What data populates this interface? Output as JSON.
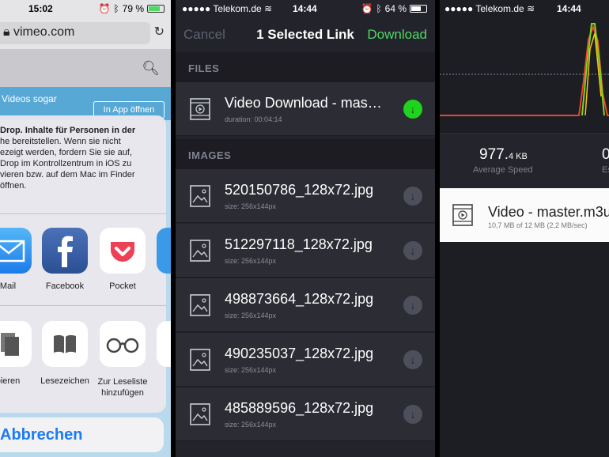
{
  "panel1": {
    "status": {
      "time": "15:02",
      "battery": "79 %",
      "battery_level": 0.79
    },
    "url": "vimeo.com",
    "web_text": "Videos sogar",
    "app_button": "In App öffnen",
    "airdrop_lines": [
      "Drop. Inhalte für Personen in der",
      "he bereitstellen. Wenn sie nicht",
      "ezeigt werden, fordern Sie sie auf,",
      "Drop im Kontrollzentrum in iOS zu",
      "vieren bzw. auf dem Mac im Finder",
      "öffnen."
    ],
    "apps": [
      {
        "label": "Mail"
      },
      {
        "label": "Facebook"
      },
      {
        "label": "Pocket"
      }
    ],
    "actions": [
      {
        "label": "pieren"
      },
      {
        "label": "Lesezeichen"
      },
      {
        "label": "Zur Leseliste"
      },
      {
        "label": "hinzufügen"
      }
    ],
    "cancel": "Abbrechen"
  },
  "panel2": {
    "status": {
      "carrier": "Telekom.de",
      "time": "14:44",
      "battery": "64 %",
      "battery_level": 0.64
    },
    "nav": {
      "cancel": "Cancel",
      "title": "1 Selected Link",
      "download": "Download"
    },
    "files_header": "FILES",
    "files": [
      {
        "title": "Video Download - mas…",
        "sub": "duration: 00:04:14"
      }
    ],
    "images_header": "IMAGES",
    "images": [
      {
        "title": "520150786_128x72.jpg",
        "sub": "size: 256x144px"
      },
      {
        "title": "512297118_128x72.jpg",
        "sub": "size: 256x144px"
      },
      {
        "title": "498873664_128x72.jpg",
        "sub": "size: 256x144px"
      },
      {
        "title": "490235037_128x72.jpg",
        "sub": "size: 256x144px"
      },
      {
        "title": "485889596_128x72.jpg",
        "sub": "size: 256x144px"
      }
    ]
  },
  "panel3": {
    "status": {
      "carrier": "Telekom.de",
      "time": "14:44"
    },
    "speed_value": "977.",
    "speed_unit": "4 KB",
    "speed_label": "Average Speed",
    "stat2_value": "0",
    "stat2_label": "Es",
    "download": {
      "title": "Video - master.m3u",
      "sub": "10,7 MB of 12 MB (2,2 MB/sec)"
    },
    "colors": {
      "red": "#e8462a",
      "green": "#7ed321",
      "yellow": "#f5c518"
    }
  }
}
